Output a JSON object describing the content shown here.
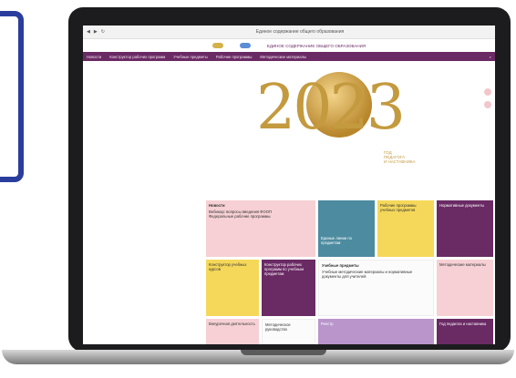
{
  "browser": {
    "tab_title": "Единое содержание общего образования"
  },
  "site": {
    "brand": "ЕДИНОЕ СОДЕРЖАНИЕ ОБЩЕГО ОБРАЗОВАНИЯ"
  },
  "nav": [
    "Новости",
    "Конструктор рабочих программ",
    "Учебные предметы",
    "Рабочие программы",
    "Методические материалы"
  ],
  "hero": {
    "year": "2023",
    "caption_line1": "ГОД",
    "caption_line2": "ПЕДАГОГА",
    "caption_line3": "И НАСТАВНИКА"
  },
  "tiles": {
    "news_title": "Новости",
    "news_item1": "Вебинар: вопросы введения ФООП",
    "news_item2": "Федеральные рабочие программы",
    "unified_title": "Единые линии по предметам",
    "programs_title": "Рабочие программы учебных предметов",
    "normative_title": "Нормативные документы",
    "constructor_course_title": "Конструктор учебных курсов",
    "constructor_programs_title": "Конструктор рабочих программ по учебным предметам",
    "subjects_title": "Учебные предметы",
    "subjects_text": "Учебные методические материалы и нормативные документы для учителей",
    "methods_title": "Методические материалы",
    "extracurricular_title": "Внеурочная деятельность",
    "guide_title": "Методическое руководство",
    "registry_title": "Реестр",
    "year_teacher_title": "Год педагога и наставника"
  },
  "colors": {
    "nav": "#6a2a64",
    "gold": "#c49a3f",
    "blue_frame": "#2b3d9c"
  }
}
